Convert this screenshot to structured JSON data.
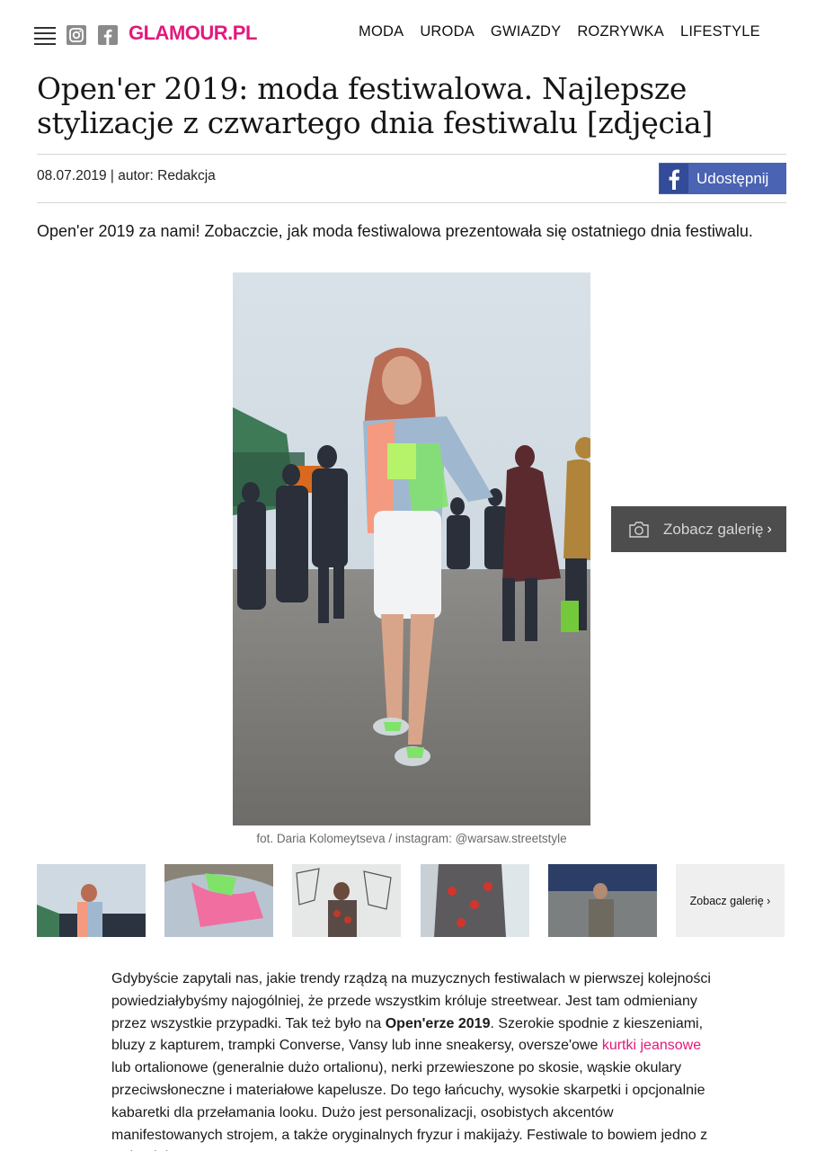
{
  "header": {
    "logo": "GLAMOUR.PL",
    "nav": [
      "MODA",
      "URODA",
      "GWIAZDY",
      "ROZRYWKA",
      "LIFESTYLE"
    ]
  },
  "article": {
    "title": "Open'er 2019: moda festiwalowa. Najlepsze stylizacje z czwartego dnia festiwalu [zdjęcia]",
    "meta": "08.07.2019 | autor: Redakcja",
    "share_label": "Udostępnij",
    "lead": "Open'er 2019 za nami! Zobaczcie, jak moda festiwalowa prezentowała się ostatniego dnia festiwalu.",
    "gallery_button": "Zobacz galerię",
    "photo_caption": "fot. Daria Kolomeytseva / instagram: @warsaw.streetstyle",
    "thumbs_more": "Zobacz galerię",
    "body": {
      "p1": "Gdybyście zapytali nas, jakie trendy rządzą na muzycznych festiwalach w pierwszej kolejności powiedziałybyśmy najogólniej, że przede wszystkim króluje streetwear. Jest tam odmieniany przez wszystkie przypadki. Tak też było na ",
      "bold": "Open'erze 2019",
      "p2": ". Szerokie spodnie z kieszeniami, bluzy z kapturem, trampki Converse, Vansy lub inne sneakersy, oversze'owe ",
      "link": "kurtki jeansowe",
      "p3": " lub ortalionowe (generalnie dużo ortalionu), nerki przewieszone po skosie, wąskie okulary przeciwsłoneczne i materiałowe kapelusze. Do tego łańcuchy, wysokie skarpetki i opcjonalnie kabaretki dla przełamania looku. Dużo jest personalizacji, osobistych akcentów manifestowanych strojem, a także oryginalnych fryzur i makijaży. Festiwale to bowiem jedno z tych miejsc, w"
    }
  },
  "colors": {
    "brand": "#e2197c",
    "facebook": "#4a63b2",
    "gallery_button_bg": "#4d4d4d"
  }
}
